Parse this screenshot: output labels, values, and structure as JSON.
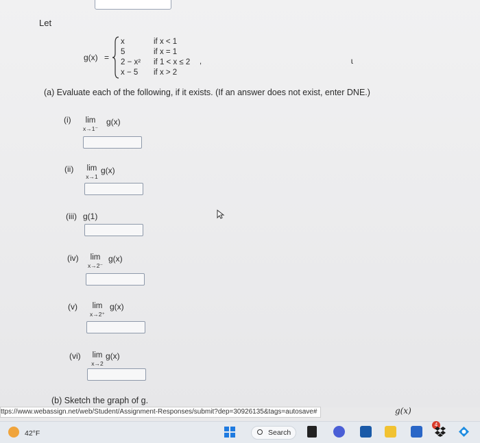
{
  "intro": {
    "let": "Let"
  },
  "function_def": {
    "label": "g(x)",
    "eq": "=",
    "pieces": [
      {
        "expr": "x",
        "cond": "if x < 1"
      },
      {
        "expr": "5",
        "cond": "if x = 1"
      },
      {
        "expr": "2 − x²",
        "cond": "if 1 < x ≤ 2"
      },
      {
        "expr": "x − 5",
        "cond": "if x > 2"
      }
    ],
    "trailing": ","
  },
  "part_a": {
    "text": "(a)   Evaluate each of the following, if it exists. (If an answer does not exist, enter DNE.)",
    "items": [
      {
        "num": "(i)",
        "lim": "lim",
        "sub": "x→1⁻",
        "func": "g(x)",
        "value": ""
      },
      {
        "num": "(ii)",
        "lim": "lim",
        "sub": "x→1",
        "func": "g(x)",
        "value": ""
      },
      {
        "num": "(iii)",
        "lim": "",
        "sub": "",
        "func": "g(1)",
        "value": ""
      },
      {
        "num": "(iv)",
        "lim": "lim",
        "sub": "x→2⁻",
        "func": "g(x)",
        "value": ""
      },
      {
        "num": "(v)",
        "lim": "lim",
        "sub": "x→2⁺",
        "func": "g(x)",
        "value": ""
      },
      {
        "num": "(vi)",
        "lim": "lim",
        "sub": "x→2",
        "func": "g(x)",
        "value": ""
      }
    ]
  },
  "part_b": {
    "text": "(b)   Sketch the graph of g."
  },
  "status_url": "ttps://www.webassign.net/web/Student/Assignment-Responses/submit?dep=30926135&tags=autosave#",
  "graph_label": "g(x)",
  "taskbar": {
    "temperature": "42°F",
    "search_label": "Search",
    "notification_count": "4"
  },
  "colors": {
    "input_border": "#8e99aa",
    "windows_blue": "#1f7be0",
    "badge_red": "#d83b2b"
  }
}
